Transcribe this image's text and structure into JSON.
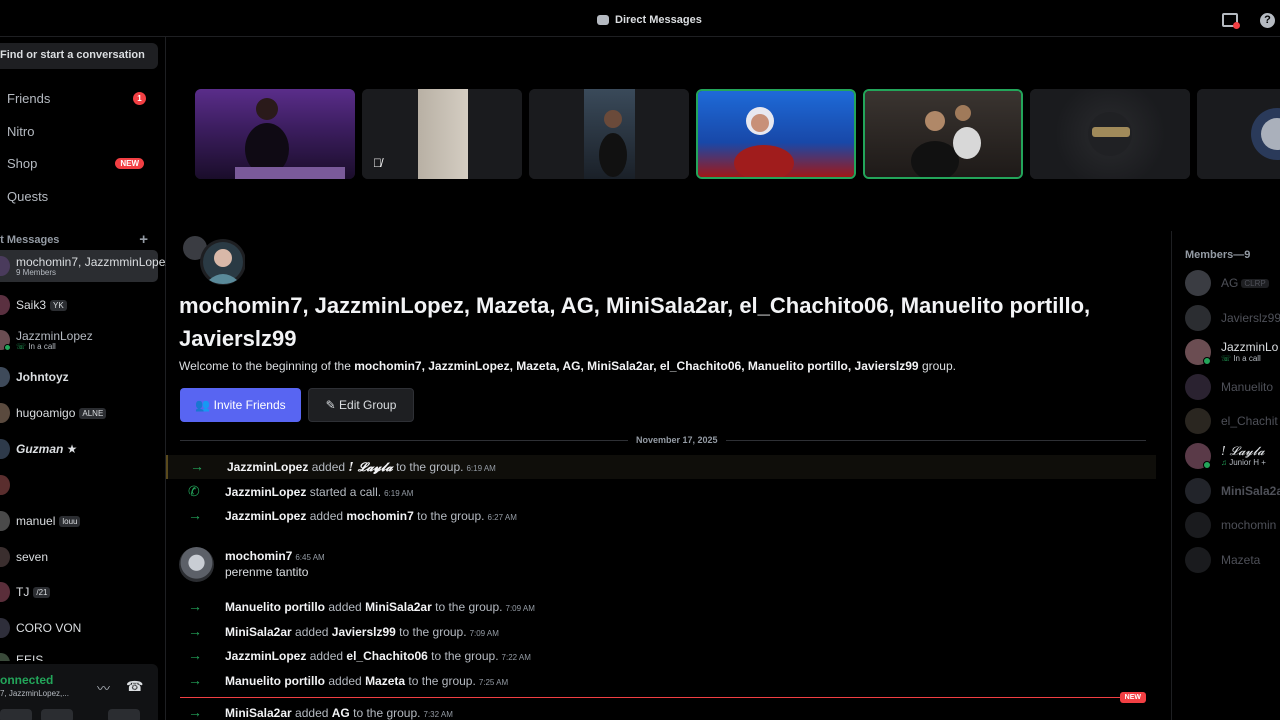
{
  "titlebar": {
    "title": "Direct Messages"
  },
  "sidebar": {
    "search_label": "Find or start a conversation",
    "nav": [
      {
        "label": "Friends",
        "badge": "1"
      },
      {
        "label": "Nitro"
      },
      {
        "label": "Shop",
        "badge": "NEW"
      },
      {
        "label": "Quests"
      }
    ],
    "dm_header": "ct Messages",
    "dms": [
      {
        "name": "mochomin7, JazzmminLopez...",
        "sub": "9 Members"
      },
      {
        "name": "Saik3",
        "tag": "YK"
      },
      {
        "name": "JazzminLopez",
        "sub": "In a call"
      },
      {
        "name": "Johntoyz"
      },
      {
        "name": "hugoamigo",
        "tag": "ALNE"
      },
      {
        "name": "Guzman ★"
      },
      {
        "name": ""
      },
      {
        "name": "manuel",
        "tag": "louu"
      },
      {
        "name": "seven"
      },
      {
        "name": "TJ",
        "tag": "/21"
      },
      {
        "name": "CORO VON"
      },
      {
        "name": "EEIS"
      }
    ],
    "voice": {
      "title": "onnected",
      "sub": "7, JazzminLopez,..."
    }
  },
  "chat": {
    "group_title": "mochomin7, JazzminLopez, Mazeta, AG, MiniSala2ar, el_Chachito06, Manuelito portillo, Javierslz99",
    "welcome_prefix": "Welcome to the beginning of the",
    "welcome_names": "mochomin7, JazzminLopez, Mazeta, AG, MiniSala2ar, el_Chachito06, Manuelito portillo, Javierslz99",
    "welcome_suffix": "group.",
    "invite_label": "Invite Friends",
    "edit_label": "Edit Group",
    "date": "November 17, 2025",
    "events": [
      {
        "actor": "JazzminLopez",
        "verb": "added",
        "target": "! 𝓛𝓪𝔂𝓵𝓪",
        "rest": "to the group.",
        "time": "6:19 AM",
        "kind": "add"
      },
      {
        "actor": "JazzminLopez",
        "verb": "started a call.",
        "target": "",
        "rest": "",
        "time": "6:19 AM",
        "kind": "call"
      },
      {
        "actor": "JazzminLopez",
        "verb": "added",
        "target": "mochomin7",
        "rest": "to the group.",
        "time": "6:27 AM",
        "kind": "add"
      },
      {
        "actor": "Manuelito portillo",
        "verb": "added",
        "target": "MiniSala2ar",
        "rest": "to the group.",
        "time": "7:09 AM",
        "kind": "add"
      },
      {
        "actor": "MiniSala2ar",
        "verb": "added",
        "target": "Javierslz99",
        "rest": "to the group.",
        "time": "7:09 AM",
        "kind": "add"
      },
      {
        "actor": "JazzminLopez",
        "verb": "added",
        "target": "el_Chachito06",
        "rest": "to the group.",
        "time": "7:22 AM",
        "kind": "add"
      },
      {
        "actor": "Manuelito portillo",
        "verb": "added",
        "target": "Mazeta",
        "rest": "to the group.",
        "time": "7:25 AM",
        "kind": "add"
      },
      {
        "actor": "MiniSala2ar",
        "verb": "added",
        "target": "AG",
        "rest": "to the group.",
        "time": "7:32 AM",
        "kind": "add"
      }
    ],
    "message": {
      "author": "mochomin7",
      "time": "6:45 AM",
      "content": "perenme tantito"
    },
    "new_label": "NEW"
  },
  "members": {
    "header": "Members—9",
    "list": [
      {
        "name": "AG",
        "tag": "CLRP"
      },
      {
        "name": "Javierslz99"
      },
      {
        "name": "JazzminLo",
        "sub": "In a call",
        "online": true
      },
      {
        "name": "Manuelito"
      },
      {
        "name": "el_Chachit"
      },
      {
        "name": "! 𝓛𝓪𝔂𝓵𝓪",
        "sub": "Junior H +",
        "online": true
      },
      {
        "name": "MiniSala2a"
      },
      {
        "name": "mochomin"
      },
      {
        "name": "Mazeta"
      }
    ]
  },
  "colors": {
    "accent": "#5865f2",
    "online": "#23a55a",
    "danger": "#f23f43"
  }
}
